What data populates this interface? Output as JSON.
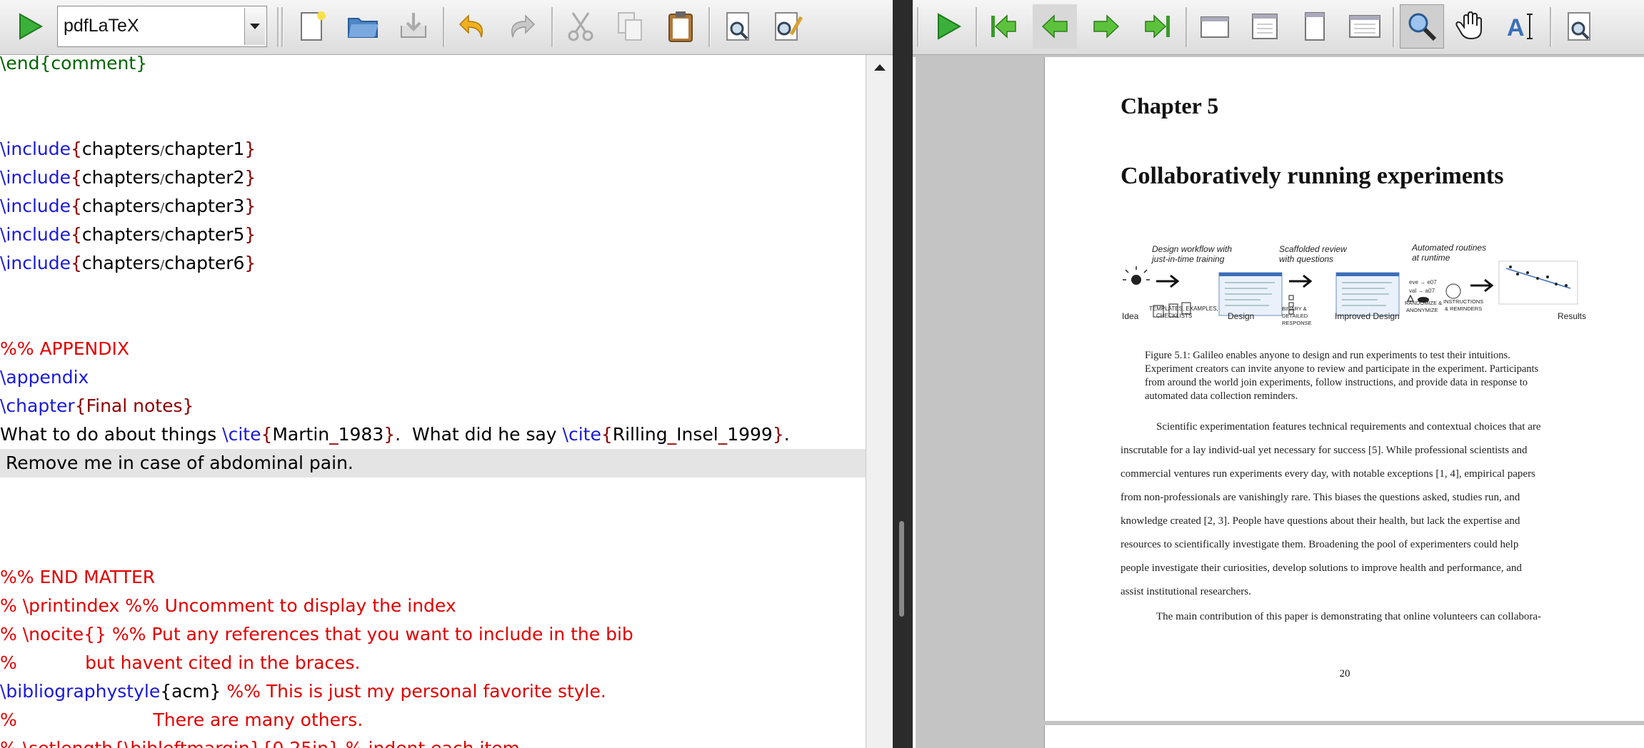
{
  "editor_toolbar": {
    "compiler_value": "pdfLaTeX",
    "icons": [
      "run-icon",
      "new-file-icon",
      "open-folder-icon",
      "save-icon",
      "undo-icon",
      "redo-icon",
      "cut-icon",
      "copy-icon",
      "paste-icon",
      "find-icon",
      "find-replace-icon"
    ]
  },
  "editor_lines": [
    {
      "parts": [
        [
          "grn",
          "\\end{comment}"
        ]
      ]
    },
    {
      "parts": []
    },
    {
      "parts": []
    },
    {
      "parts": [
        [
          "cmd",
          "\\include"
        ],
        [
          "brc",
          "{"
        ],
        [
          "arg",
          "chapters"
        ],
        [
          "sep",
          "/"
        ],
        [
          "arg",
          "chapter1"
        ],
        [
          "brc",
          "}"
        ]
      ]
    },
    {
      "parts": [
        [
          "cmd",
          "\\include"
        ],
        [
          "brc",
          "{"
        ],
        [
          "arg",
          "chapters"
        ],
        [
          "sep",
          "/"
        ],
        [
          "arg",
          "chapter2"
        ],
        [
          "brc",
          "}"
        ]
      ]
    },
    {
      "parts": [
        [
          "cmd",
          "\\include"
        ],
        [
          "brc",
          "{"
        ],
        [
          "arg",
          "chapters"
        ],
        [
          "sep",
          "/"
        ],
        [
          "arg",
          "chapter3"
        ],
        [
          "brc",
          "}"
        ]
      ]
    },
    {
      "parts": [
        [
          "cmd",
          "\\include"
        ],
        [
          "brc",
          "{"
        ],
        [
          "arg",
          "chapters"
        ],
        [
          "sep",
          "/"
        ],
        [
          "arg",
          "chapter5"
        ],
        [
          "brc",
          "}"
        ]
      ]
    },
    {
      "parts": [
        [
          "cmd",
          "\\include"
        ],
        [
          "brc",
          "{"
        ],
        [
          "arg",
          "chapters"
        ],
        [
          "sep",
          "/"
        ],
        [
          "arg",
          "chapter6"
        ],
        [
          "brc",
          "}"
        ]
      ]
    },
    {
      "parts": []
    },
    {
      "parts": []
    },
    {
      "parts": [
        [
          "cmt",
          "%% APPENDIX"
        ]
      ]
    },
    {
      "parts": [
        [
          "cmd",
          "\\appendix"
        ]
      ]
    },
    {
      "parts": [
        [
          "cmd",
          "\\chapter"
        ],
        [
          "brc",
          "{"
        ],
        [
          "brc",
          "Final notes"
        ],
        [
          "brc",
          "}"
        ]
      ]
    },
    {
      "parts": [
        [
          "txt",
          "What to do about things "
        ],
        [
          "cmd",
          "\\cite"
        ],
        [
          "brc",
          "{"
        ],
        [
          "arg",
          "Martin"
        ],
        [
          "brc",
          "_"
        ],
        [
          "arg",
          "1983"
        ],
        [
          "brc",
          "}"
        ],
        [
          "txt",
          "."
        ],
        [
          "txt",
          "  What did he say "
        ],
        [
          "cmd",
          "\\cite"
        ],
        [
          "brc",
          "{"
        ],
        [
          "arg",
          "Rilling"
        ],
        [
          "brc",
          "_"
        ],
        [
          "arg",
          "Insel"
        ],
        [
          "brc",
          "_"
        ],
        [
          "arg",
          "1999"
        ],
        [
          "brc",
          "}"
        ],
        [
          "txt",
          "."
        ]
      ]
    },
    {
      "parts": [
        [
          "txt",
          " Remove me in case of abdominal pain"
        ],
        [
          "txt",
          "."
        ]
      ],
      "current": true
    },
    {
      "parts": []
    },
    {
      "parts": []
    },
    {
      "parts": []
    },
    {
      "parts": [
        [
          "cmt",
          "%% END MATTER"
        ]
      ]
    },
    {
      "parts": [
        [
          "cmt",
          "% \\printindex %% Uncomment to display the index"
        ]
      ]
    },
    {
      "parts": [
        [
          "cmt",
          "% \\nocite{} %% Put any references that you want to include in the bib"
        ]
      ]
    },
    {
      "parts": [
        [
          "cmt",
          "%            but havent cited in the braces."
        ]
      ]
    },
    {
      "parts": [
        [
          "cmd",
          "\\bibliographystyle"
        ],
        [
          "arg",
          "{acm}"
        ],
        [
          "cmt",
          " %% This is just my personal favorite style."
        ]
      ]
    },
    {
      "parts": [
        [
          "cmt",
          "%                        There are many others."
        ]
      ]
    },
    {
      "parts": [
        [
          "cmt",
          "% \\setlength{\\bibleftmargin}{0.25in} % indent each item"
        ]
      ]
    }
  ],
  "viewer_toolbar": {
    "icons": [
      "compile-icon",
      "first-page-icon",
      "previous-page-icon",
      "next-page-icon",
      "last-page-icon",
      "single-page-icon",
      "double-page-icon",
      "continuous-icon",
      "facing-pages-icon",
      "zoom-icon",
      "hand-tool-icon",
      "text-select-icon",
      "find-icon"
    ]
  },
  "pdf": {
    "chapter_number": "Chapter 5",
    "chapter_title": "Collaboratively running experiments",
    "figure": {
      "step1_label": "Design workflow with",
      "step1_label2": "just-in-time training",
      "step2_label": "Scaffolded review",
      "step2_label2": "with questions",
      "step3_label": "Automated routines",
      "step3_label2": "at runtime",
      "idea": "Idea",
      "design": "Design",
      "improved_design": "Improved Design",
      "results": "Results",
      "templates": "TEMPLATES, EXAMPLES,",
      "checklists": "CHECKLISTS",
      "binary": "BINARY &",
      "detailed": "DETAILED",
      "response": "RESPONSE",
      "randomize": "RANDOMIZE &",
      "anonymize": "ANONYMIZE",
      "instructions": "INSTRUCTIONS",
      "reminders": "& REMINDERS"
    },
    "caption_lines": [
      "Figure 5.1: Galileo enables anyone to design and run experiments to test their intuitions.",
      "Experiment creators can invite anyone to review and participate in the experiment. Participants",
      "from around the world join experiments, follow instructions, and provide data in response to",
      "automated data collection reminders."
    ],
    "paragraph_lines": [
      "Scientific experimentation features technical requirements and contextual choices that are",
      "inscrutable for a lay individ-ual yet necessary for success [5]. While professional scientists and",
      "commercial ventures run experiments every day, with notable exceptions [1, 4], empirical papers",
      "from non-professionals are vanishingly rare. This biases the questions asked, studies run, and",
      "knowledge created [2, 3]. People have questions about their health, but lack the expertise and",
      "resources to scientifically investigate them. Broadening the pool of experimenters could help",
      "people investigate their curiosities, develop solutions to improve health and performance, and",
      "assist institutional researchers.",
      "The main contribution of this paper is demonstrating that online volunteers can collabora-"
    ],
    "page_number": "20"
  }
}
